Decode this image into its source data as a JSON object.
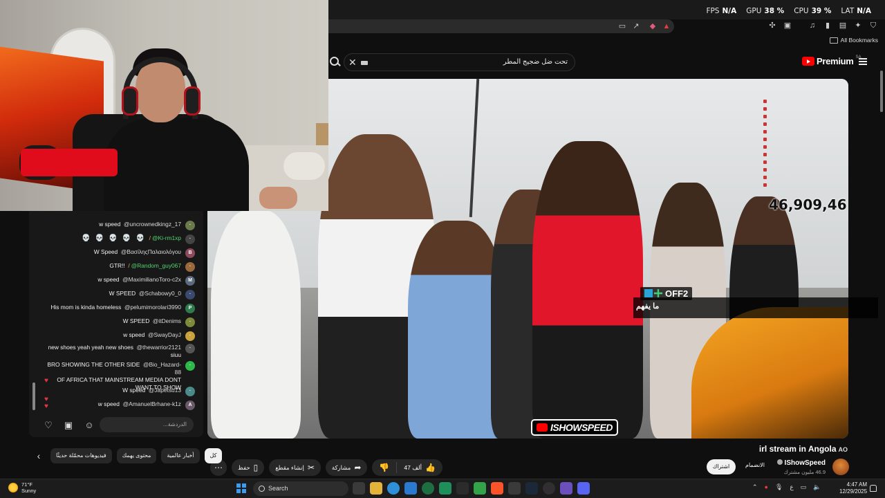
{
  "overlay": {
    "fps_label": "FPS",
    "fps_value": "N/A",
    "gpu_label": "GPU",
    "gpu_value": "38",
    "cpu_label": "CPU",
    "cpu_value": "39",
    "lat_label": "LAT",
    "lat_value": "N/A"
  },
  "bookmarks": {
    "label": "All Bookmarks"
  },
  "youtube": {
    "search_query": "تحت ضل ضجيج المطر",
    "logo_text": "Premium",
    "logo_region": "SA"
  },
  "video": {
    "viewer_count": "46,909,46",
    "overlay_tag": "OFF2",
    "subtitle": "ما يفهم",
    "watermark": "ISHOWSPEED",
    "title": "irl stream in Angola",
    "title_suffix": "AO"
  },
  "channel": {
    "name": "IShowSpeed",
    "subscribers": "46.9 مليون مشترك",
    "join_label": "الانضمام",
    "subscribe_label": "اشتراك"
  },
  "actions": {
    "like_count": "47 ألف",
    "share_label": "مشاركة",
    "clip_label": "إنشاء مقطع",
    "save_label": "حفظ"
  },
  "chips": [
    "كل",
    "أخبار عالمية",
    "محتوى يهمك",
    "فيديوهات محمّلة حديثًا"
  ],
  "chat": {
    "input_placeholder": "الدردشة...",
    "messages": [
      {
        "text": "w speed",
        "user": "@uncrownedkingz_17"
      },
      {
        "text": "💀 💀 💀 💀 💀",
        "user": "@Ki-rm1xp"
      },
      {
        "text": "W Speed",
        "user": "@ΒασίληςΠαλαιολόγου"
      },
      {
        "text": "GTR!!",
        "user": "@Random_guy067"
      },
      {
        "text": "w speed",
        "user": "@MaximilianoToro-c2x"
      },
      {
        "text": "W SPEED",
        "user": "@Schabowy0_0"
      },
      {
        "text": "His mom is kinda homeless",
        "user": "@pelumimorolari3990"
      },
      {
        "text": "W SPEED",
        "user": "@itDenims"
      },
      {
        "text": "w speed",
        "user": "@SwayDayJ"
      },
      {
        "text": "new shoes yeah yeah new shoes",
        "user": "@thewarrior2121",
        "text2": "siuu"
      },
      {
        "text": "BRO SHOWING THE OTHER SIDE",
        "user": "@Bio_Hazard-88",
        "text2": "OF AFRICA THAT MAINSTREAM MEDIA DONT WANT TO SHOW"
      },
      {
        "text": "W speed",
        "user": "@Japetsu13"
      },
      {
        "text": "w speed",
        "user": "@AmanuelBrhane-k1z"
      }
    ]
  },
  "taskbar": {
    "temp": "71°F",
    "condition": "Sunny",
    "search_label": "Search",
    "time": "4:47 AM",
    "date": "12/29/2025",
    "lang": "ع"
  },
  "colors": {
    "yt_red": "#ff0000",
    "bg": "#0f0f0f",
    "pill": "#272727"
  }
}
